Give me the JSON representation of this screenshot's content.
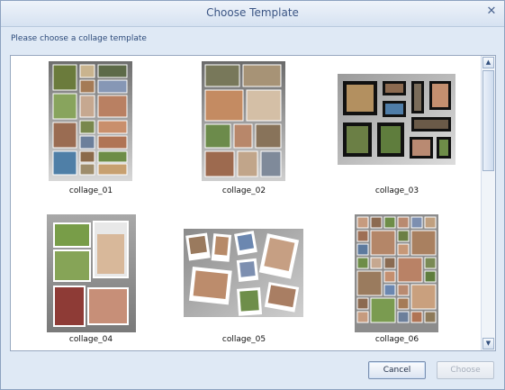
{
  "window": {
    "title": "Choose Template",
    "close_icon": "close-icon"
  },
  "prompt": "Please choose a collage template",
  "templates": [
    {
      "caption": "collage_01"
    },
    {
      "caption": "collage_02"
    },
    {
      "caption": "collage_03"
    },
    {
      "caption": "collage_04"
    },
    {
      "caption": "collage_05"
    },
    {
      "caption": "collage_06"
    }
  ],
  "scrollbar": {
    "up_icon": "chevron-up-icon",
    "down_icon": "chevron-down-icon"
  },
  "buttons": {
    "cancel": "Cancel",
    "choose": "Choose"
  },
  "colors": {
    "title_text": "#3b5584",
    "dialog_bg": "#dfe9f5",
    "list_bg": "#ffffff"
  }
}
